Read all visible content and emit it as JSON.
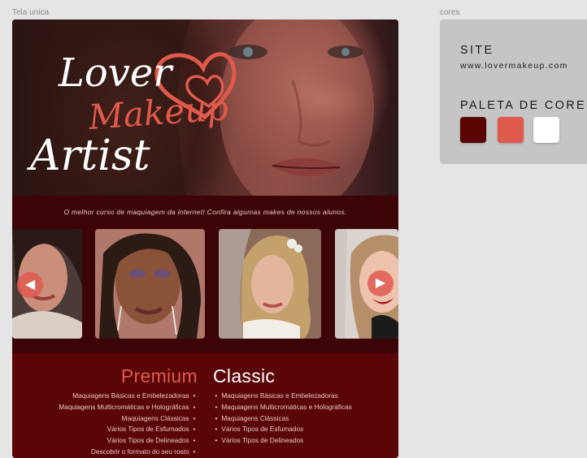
{
  "canvas": {
    "main_frame_label": "Tela unica",
    "side_frame_label": "cores"
  },
  "hero": {
    "logo_line1": "Lover",
    "logo_line2": "Makeup",
    "logo_line3": "Artist",
    "logo_colors": {
      "script": "#ffffff",
      "accent": "#e05a4c"
    }
  },
  "tagline": "O melhor curso de maquiagem da internet! Confira algumas makes de nossos alunos.",
  "carousel": {
    "prev_icon": "chevron-left-icon",
    "next_icon": "chevron-right-icon",
    "photo_count": 4
  },
  "courses": {
    "premium": {
      "title": "Premium",
      "items": [
        "Maquiagens Básicas e Embelezadoras",
        "Maquiagens Multicromáticas e Holográficas",
        "Maquiagens Clássicas",
        "Vários Tipos de Esfumados",
        "Vários Tipos de Delineados",
        "Descobrir o formato do seu rosto"
      ]
    },
    "classic": {
      "title": "Classic",
      "items": [
        "Maquiagens Básicas e Embelezadoras",
        "Maquiagens Multicromáticas e Holográficas",
        "Maquiagens Clássicas",
        "Vários Tipos de Esfumados",
        "Vários Tipos de Delineados"
      ]
    },
    "bullet": "•"
  },
  "colors_panel": {
    "site_heading": "SITE",
    "site_url": "www.lovermakeup.com",
    "palette_heading": "PALETA DE CORES",
    "swatches": [
      "#5a0504",
      "#e05a4c",
      "#ffffff"
    ]
  }
}
